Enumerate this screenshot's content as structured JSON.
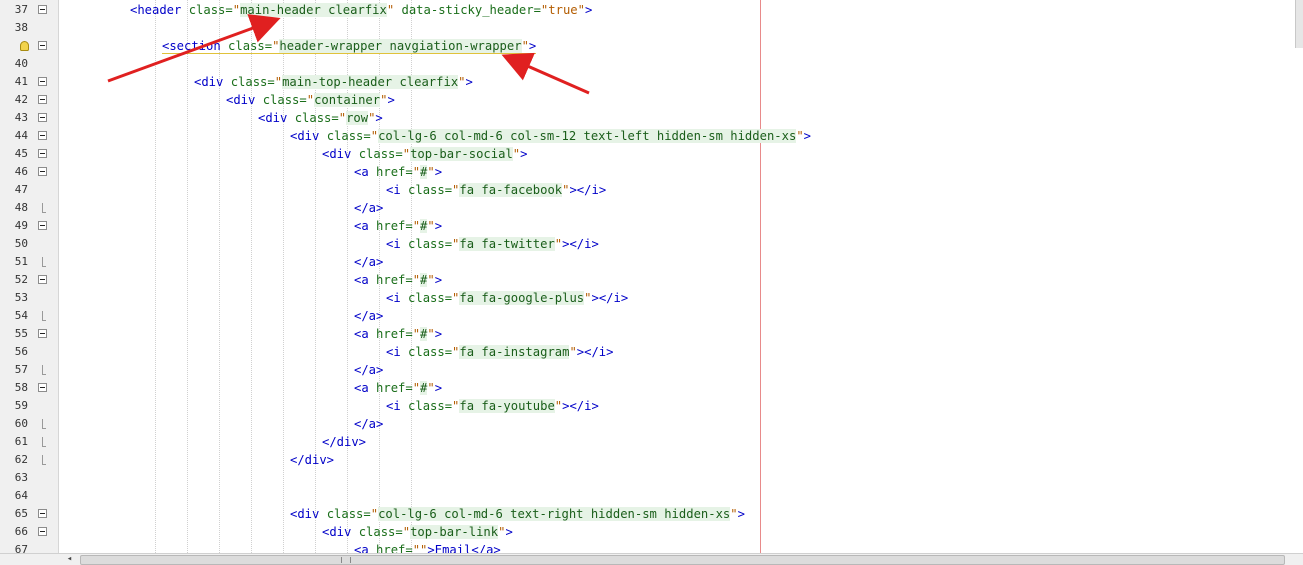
{
  "gutter": {
    "lines": [
      {
        "num": "37",
        "marker": "fold"
      },
      {
        "num": "38",
        "marker": "none"
      },
      {
        "num": "",
        "marker": "fold-bulb"
      },
      {
        "num": "40",
        "marker": "none"
      },
      {
        "num": "41",
        "marker": "fold"
      },
      {
        "num": "42",
        "marker": "fold"
      },
      {
        "num": "43",
        "marker": "fold"
      },
      {
        "num": "44",
        "marker": "fold"
      },
      {
        "num": "45",
        "marker": "fold"
      },
      {
        "num": "46",
        "marker": "fold"
      },
      {
        "num": "47",
        "marker": "none"
      },
      {
        "num": "48",
        "marker": "end"
      },
      {
        "num": "49",
        "marker": "fold"
      },
      {
        "num": "50",
        "marker": "none"
      },
      {
        "num": "51",
        "marker": "end"
      },
      {
        "num": "52",
        "marker": "fold"
      },
      {
        "num": "53",
        "marker": "none"
      },
      {
        "num": "54",
        "marker": "end"
      },
      {
        "num": "55",
        "marker": "fold"
      },
      {
        "num": "56",
        "marker": "none"
      },
      {
        "num": "57",
        "marker": "end"
      },
      {
        "num": "58",
        "marker": "fold"
      },
      {
        "num": "59",
        "marker": "none"
      },
      {
        "num": "60",
        "marker": "end"
      },
      {
        "num": "61",
        "marker": "end"
      },
      {
        "num": "62",
        "marker": "end"
      },
      {
        "num": "63",
        "marker": "none"
      },
      {
        "num": "64",
        "marker": "none"
      },
      {
        "num": "65",
        "marker": "fold"
      },
      {
        "num": "66",
        "marker": "fold"
      },
      {
        "num": "67",
        "marker": "none"
      }
    ]
  },
  "code": {
    "lines": [
      {
        "indent": 2,
        "parts": [
          [
            "tag",
            "<header "
          ],
          [
            "attr",
            "class="
          ],
          [
            "val",
            "main-header clearfix"
          ],
          [
            "attr",
            " data-sticky_header="
          ],
          [
            "valplain",
            "true"
          ],
          [
            "tag",
            ">"
          ]
        ]
      },
      {
        "indent": 0,
        "parts": []
      },
      {
        "indent": 3,
        "warn": true,
        "parts": [
          [
            "tag",
            "<section "
          ],
          [
            "attr",
            "class="
          ],
          [
            "val",
            "header-wrapper navgiation-wrapper"
          ],
          [
            "tag",
            ">"
          ]
        ]
      },
      {
        "indent": 0,
        "parts": []
      },
      {
        "indent": 4,
        "parts": [
          [
            "tag",
            "<div "
          ],
          [
            "attr",
            "class="
          ],
          [
            "val",
            "main-top-header clearfix"
          ],
          [
            "tag",
            ">"
          ]
        ]
      },
      {
        "indent": 5,
        "parts": [
          [
            "tag",
            "<div "
          ],
          [
            "attr",
            "class="
          ],
          [
            "val",
            "container"
          ],
          [
            "tag",
            ">"
          ]
        ]
      },
      {
        "indent": 6,
        "parts": [
          [
            "tag",
            "<div "
          ],
          [
            "attr",
            "class="
          ],
          [
            "val",
            "row"
          ],
          [
            "tag",
            ">"
          ]
        ]
      },
      {
        "indent": 7,
        "parts": [
          [
            "tag",
            "<div "
          ],
          [
            "attr",
            "class="
          ],
          [
            "val",
            "col-lg-6 col-md-6 col-sm-12 text-left hidden-sm hidden-xs"
          ],
          [
            "tag",
            ">"
          ]
        ]
      },
      {
        "indent": 8,
        "parts": [
          [
            "tag",
            "<div "
          ],
          [
            "attr",
            "class="
          ],
          [
            "val",
            "top-bar-social"
          ],
          [
            "tag",
            ">"
          ]
        ]
      },
      {
        "indent": 9,
        "parts": [
          [
            "tag",
            "<a "
          ],
          [
            "attr",
            "href="
          ],
          [
            "val",
            "#"
          ],
          [
            "tag",
            ">"
          ]
        ]
      },
      {
        "indent": 10,
        "parts": [
          [
            "tag",
            "<i "
          ],
          [
            "attr",
            "class="
          ],
          [
            "val",
            "fa fa-facebook"
          ],
          [
            "tag",
            "></i>"
          ]
        ]
      },
      {
        "indent": 9,
        "parts": [
          [
            "tag",
            "</a>"
          ]
        ]
      },
      {
        "indent": 9,
        "parts": [
          [
            "tag",
            "<a "
          ],
          [
            "attr",
            "href="
          ],
          [
            "val",
            "#"
          ],
          [
            "tag",
            ">"
          ]
        ]
      },
      {
        "indent": 10,
        "parts": [
          [
            "tag",
            "<i "
          ],
          [
            "attr",
            "class="
          ],
          [
            "val",
            "fa fa-twitter"
          ],
          [
            "tag",
            "></i>"
          ]
        ]
      },
      {
        "indent": 9,
        "parts": [
          [
            "tag",
            "</a>"
          ]
        ]
      },
      {
        "indent": 9,
        "parts": [
          [
            "tag",
            "<a "
          ],
          [
            "attr",
            "href="
          ],
          [
            "val",
            "#"
          ],
          [
            "tag",
            ">"
          ]
        ]
      },
      {
        "indent": 10,
        "parts": [
          [
            "tag",
            "<i "
          ],
          [
            "attr",
            "class="
          ],
          [
            "val",
            "fa fa-google-plus"
          ],
          [
            "tag",
            "></i>"
          ]
        ]
      },
      {
        "indent": 9,
        "parts": [
          [
            "tag",
            "</a>"
          ]
        ]
      },
      {
        "indent": 9,
        "parts": [
          [
            "tag",
            "<a "
          ],
          [
            "attr",
            "href="
          ],
          [
            "val",
            "#"
          ],
          [
            "tag",
            ">"
          ]
        ]
      },
      {
        "indent": 10,
        "parts": [
          [
            "tag",
            "<i "
          ],
          [
            "attr",
            "class="
          ],
          [
            "val",
            "fa fa-instagram"
          ],
          [
            "tag",
            "></i>"
          ]
        ]
      },
      {
        "indent": 9,
        "parts": [
          [
            "tag",
            "</a>"
          ]
        ]
      },
      {
        "indent": 9,
        "parts": [
          [
            "tag",
            "<a "
          ],
          [
            "attr",
            "href="
          ],
          [
            "val",
            "#"
          ],
          [
            "tag",
            ">"
          ]
        ]
      },
      {
        "indent": 10,
        "parts": [
          [
            "tag",
            "<i "
          ],
          [
            "attr",
            "class="
          ],
          [
            "val",
            "fa fa-youtube"
          ],
          [
            "tag",
            "></i>"
          ]
        ]
      },
      {
        "indent": 9,
        "parts": [
          [
            "tag",
            "</a>"
          ]
        ]
      },
      {
        "indent": 8,
        "parts": [
          [
            "tag",
            "</div>"
          ]
        ]
      },
      {
        "indent": 7,
        "parts": [
          [
            "tag",
            "</div>"
          ]
        ]
      },
      {
        "indent": 0,
        "parts": []
      },
      {
        "indent": 0,
        "parts": []
      },
      {
        "indent": 7,
        "parts": [
          [
            "tag",
            "<div "
          ],
          [
            "attr",
            "class="
          ],
          [
            "val",
            "col-lg-6 col-md-6 text-right hidden-sm hidden-xs"
          ],
          [
            "tag",
            ">"
          ]
        ]
      },
      {
        "indent": 8,
        "parts": [
          [
            "tag",
            "<div "
          ],
          [
            "attr",
            "class="
          ],
          [
            "val",
            "top-bar-link"
          ],
          [
            "tag",
            ">"
          ]
        ]
      },
      {
        "indent": 9,
        "parts": [
          [
            "tag",
            "<a "
          ],
          [
            "attr",
            "href="
          ],
          [
            "val",
            ""
          ],
          [
            "tag",
            ">Email</a>"
          ]
        ]
      }
    ]
  },
  "colors": {
    "margin_line": "#e88a8a",
    "arrow": "#e02020",
    "tag": "#0000c8",
    "attribute": "#1a6e1a",
    "value": "#b35c00"
  },
  "icons": {
    "fold": "fold-collapse-icon",
    "bulb": "lightbulb-hint-icon",
    "arrow_left": "scroll-left-icon",
    "grip": "scroll-grip-icon"
  }
}
